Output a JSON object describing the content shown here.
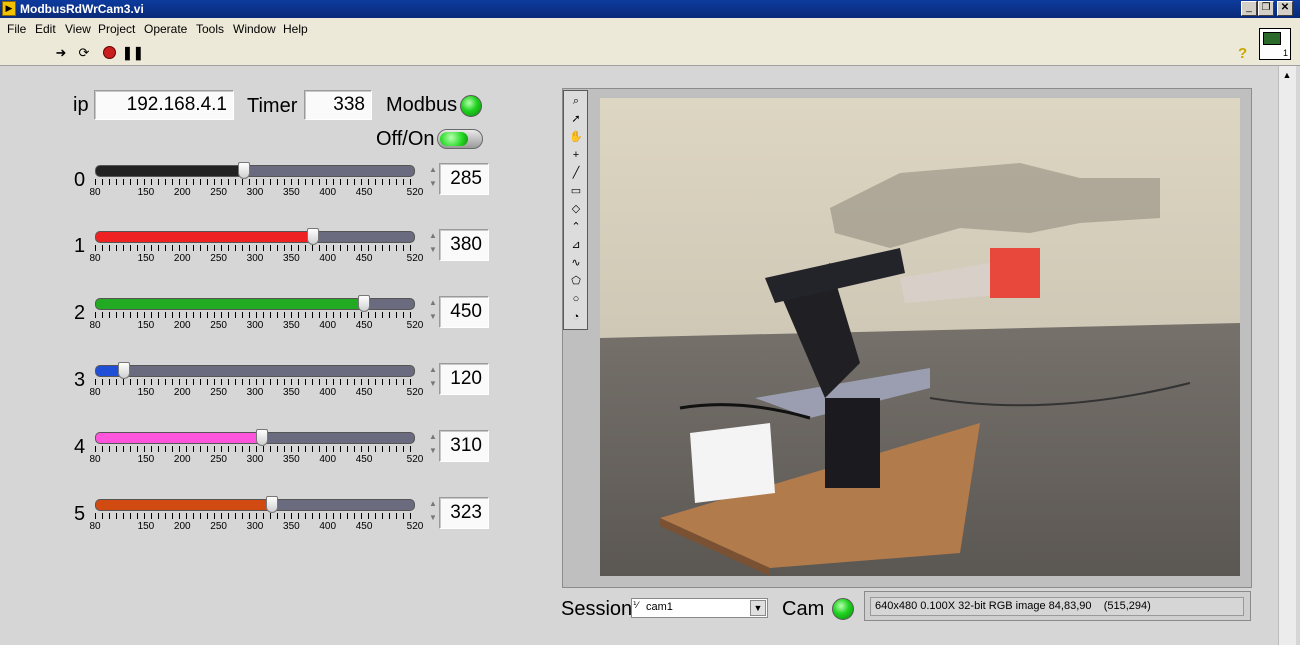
{
  "window": {
    "title": "ModbusRdWrCam3.vi",
    "app_icon": "labview-run-icon"
  },
  "menu": [
    "File",
    "Edit",
    "View",
    "Project",
    "Operate",
    "Tools",
    "Window",
    "Help"
  ],
  "toolbar": [
    "run-arrow-icon",
    "run-continuously-icon",
    "abort-icon",
    "pause-icon"
  ],
  "connection": {
    "ip_label": "ip",
    "ip_value": "192.168.4.1",
    "timer_label": "Timer",
    "timer_value": "338",
    "modbus_label": "Modbus",
    "modbus_led": "on",
    "switch_label": "Off/On",
    "switch_state": "on"
  },
  "slider_scale": {
    "min": 80,
    "max": 520,
    "labels": [
      "80",
      "150",
      "200",
      "250",
      "300",
      "350",
      "400",
      "450",
      "520"
    ]
  },
  "sliders": [
    {
      "index": "0",
      "value": "285",
      "color": "#222222"
    },
    {
      "index": "1",
      "value": "380",
      "color": "#ee2222"
    },
    {
      "index": "2",
      "value": "450",
      "color": "#22aa22"
    },
    {
      "index": "3",
      "value": "120",
      "color": "#1f4fd6"
    },
    {
      "index": "4",
      "value": "310",
      "color": "#ff55dd"
    },
    {
      "index": "5",
      "value": "323",
      "color": "#d04a12"
    }
  ],
  "image_tools": [
    "zoom-icon",
    "pointer-icon",
    "pan-icon",
    "crosshair-icon",
    "line-icon",
    "rectangle-icon",
    "rotated-rect-icon",
    "polyline-icon",
    "broken-line-icon",
    "freehand-icon",
    "polygon-icon",
    "oval-icon",
    "annulus-icon"
  ],
  "camera": {
    "session_label": "Session",
    "session_value": "cam1",
    "cam_label": "Cam",
    "cam_led": "on",
    "image_info": "640x480 0.100X 32-bit RGB image 84,83,90    (515,294)"
  }
}
